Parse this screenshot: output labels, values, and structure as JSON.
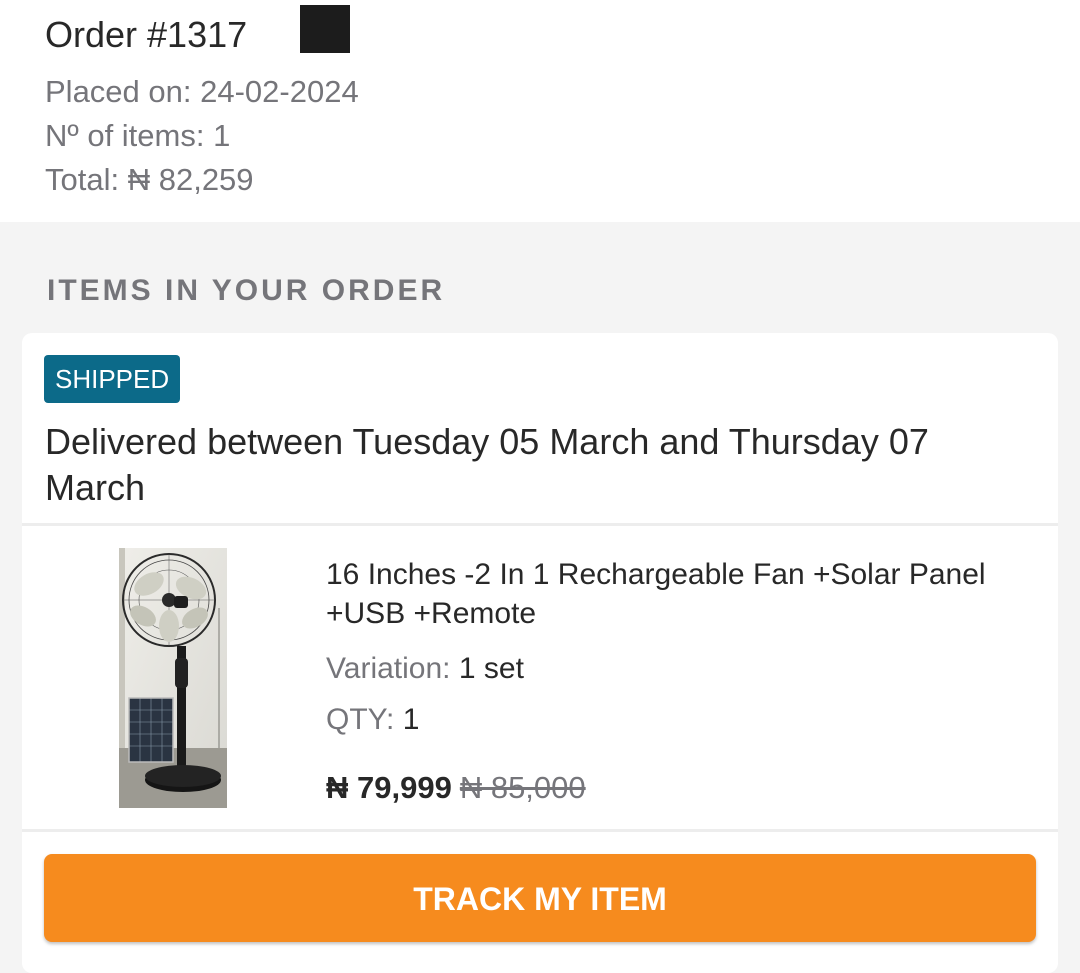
{
  "order": {
    "title": "Order #1317",
    "placed_label": "Placed on: ",
    "placed_value": "24-02-2024",
    "items_label": "Nº of items: ",
    "items_value": "1",
    "total_label": "Total: ",
    "total_value": "₦ 82,259"
  },
  "section": {
    "title": "ITEMS IN YOUR ORDER"
  },
  "item": {
    "status": "SHIPPED",
    "status_color": "#0c6a89",
    "delivery": "Delivered between Tuesday 05 March and Thursday 07 March",
    "name": "16 Inches -2 In 1 Rechargeable Fan +Solar Panel +USB +Remote",
    "variation_label": "Variation: ",
    "variation_value": "1 set",
    "qty_label": "QTY: ",
    "qty_value": "1",
    "price": "₦ 79,999",
    "old_price": "₦ 85,000",
    "image_icon": "standing-fan-solar-panel-image"
  },
  "actions": {
    "track_label": "TRACK MY ITEM",
    "accent_color": "#f68b1e"
  }
}
